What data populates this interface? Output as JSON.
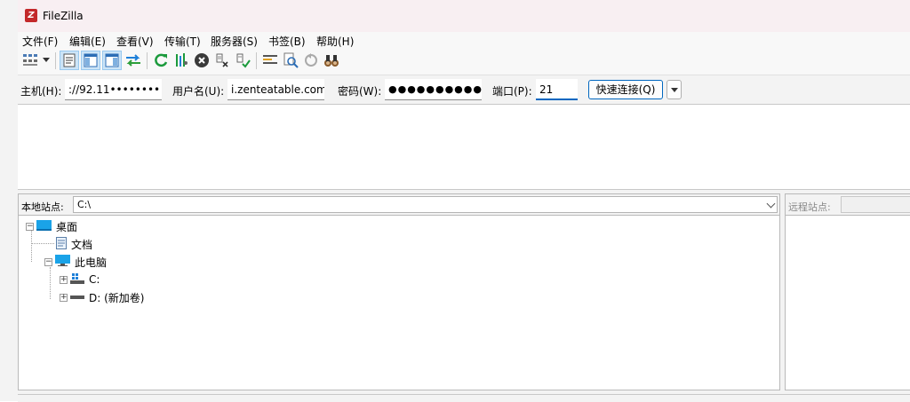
{
  "window": {
    "title": "FileZilla"
  },
  "menu": [
    "文件(F)",
    "编辑(E)",
    "查看(V)",
    "传输(T)",
    "服务器(S)",
    "书签(B)",
    "帮助(H)"
  ],
  "toolbar": {
    "buttons": [
      "site-manager-icon",
      "dropdown-arrow-icon",
      "toggle-message-log-icon",
      "toggle-local-tree-icon",
      "toggle-remote-tree-icon",
      "toggle-transfer-queue-icon",
      "refresh-icon",
      "process-queue-icon",
      "cancel-icon",
      "disconnect-icon",
      "reconnect-icon",
      "directory-filter-icon",
      "compare-directories-icon",
      "synchronized-browsing-icon",
      "search-files-icon"
    ]
  },
  "quickconnect": {
    "host_label": "主机(H):",
    "host_value": "://92.11••••••••",
    "user_label": "用户名(U):",
    "user_value": "i.zenteatable.com",
    "password_label": "密码(W):",
    "password_value": "●●●●●●●●●●●",
    "port_label": "端口(P):",
    "port_value": "21",
    "connect_label": "快速连接(Q)"
  },
  "local": {
    "site_label": "本地站点:",
    "path": "C:\\",
    "tree": {
      "desktop": "桌面",
      "documents": "文档",
      "this_pc": "此电脑",
      "drive_c": "C:",
      "drive_d": "D: (新加卷)"
    }
  },
  "remote": {
    "site_label": "远程站点:"
  },
  "colors": {
    "accent": "#0067c0",
    "title_bg": "#f8eff2",
    "app_icon": "#c3282a"
  }
}
